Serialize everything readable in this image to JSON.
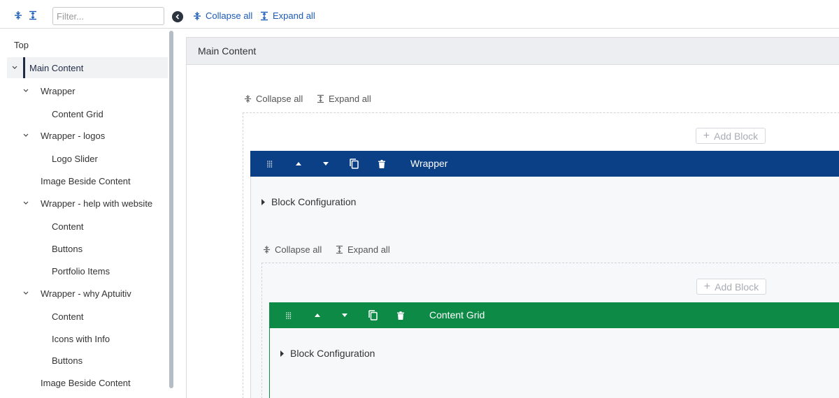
{
  "toolbar": {
    "filter_placeholder": "Filter...",
    "collapse_all": "Collapse all",
    "expand_all": "Expand all"
  },
  "sidebar": {
    "items": [
      {
        "label": "Top"
      },
      {
        "label": "Main Content"
      },
      {
        "label": "Wrapper"
      },
      {
        "label": "Content Grid"
      },
      {
        "label": "Wrapper - logos"
      },
      {
        "label": "Logo Slider"
      },
      {
        "label": "Image Beside Content"
      },
      {
        "label": "Wrapper - help with website"
      },
      {
        "label": "Content"
      },
      {
        "label": "Buttons"
      },
      {
        "label": "Portfolio Items"
      },
      {
        "label": "Wrapper - why Aptuitiv"
      },
      {
        "label": "Content"
      },
      {
        "label": "Icons with Info"
      },
      {
        "label": "Buttons"
      },
      {
        "label": "Image Beside Content"
      }
    ]
  },
  "main": {
    "header": "Main Content",
    "collapse_all": "Collapse all",
    "expand_all": "Expand all",
    "add_block": "Add Block",
    "blocks": [
      {
        "title": "Wrapper",
        "color": "#0b3f86",
        "config_label": "Block Configuration",
        "collapse_all": "Collapse all",
        "expand_all": "Expand all",
        "add_block": "Add Block"
      },
      {
        "title": "Content Grid",
        "color": "#0e8a47",
        "config_label": "Block Configuration"
      }
    ]
  }
}
